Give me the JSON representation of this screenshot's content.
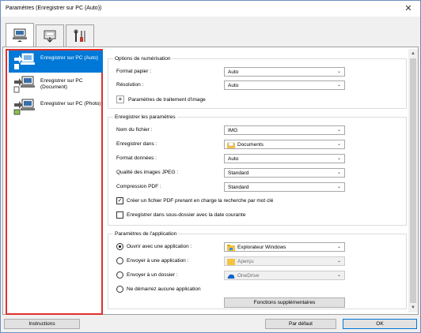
{
  "window": {
    "title": "Paramètres (Enregistrer sur PC (Auto))",
    "close_symbol": "✕"
  },
  "tabs": [
    {
      "icon": "scan-from-computer-icon"
    },
    {
      "icon": "scan-from-operation-panel-icon"
    },
    {
      "icon": "general-settings-tools-icon"
    }
  ],
  "sidebar": {
    "items": [
      {
        "label": "Enregistrer sur PC (Auto)",
        "icon": "save-to-pc-auto-icon",
        "selected": true
      },
      {
        "label": "Enregistrer sur PC (Document)",
        "icon": "save-to-pc-document-icon",
        "selected": false
      },
      {
        "label": "Enregistrer sur PC (Photo)",
        "icon": "save-to-pc-photo-icon",
        "selected": false
      }
    ]
  },
  "scan_options": {
    "title": "Options de numérisation",
    "paper_size_label": "Format papier :",
    "paper_size_value": "Auto",
    "resolution_label": "Résolution :",
    "resolution_value": "Auto",
    "image_processing_label": "Paramètres de traitement d'image",
    "expand_symbol": "+"
  },
  "save_settings": {
    "title": "Enregistrer les paramètres",
    "file_name_label": "Nom du fichier :",
    "file_name_value": "IMG",
    "save_in_label": "Enregistrer dans :",
    "save_in_value": "Documents",
    "data_format_label": "Format données :",
    "data_format_value": "Auto",
    "jpeg_quality_label": "Qualité des images JPEG :",
    "jpeg_quality_value": "Standard",
    "pdf_compression_label": "Compression PDF :",
    "pdf_compression_value": "Standard",
    "keyword_pdf_label": "Créer un fichier PDF prenant en charge la recherche par mot clé",
    "keyword_pdf_checked": true,
    "subfolder_label": "Enregistrer dans sous-dossier avec la date courante",
    "subfolder_checked": false,
    "check_symbol": "✓"
  },
  "app_settings": {
    "title": "Paramètres de l'application",
    "open_app_label": "Ouvrir avec une application :",
    "open_app_value": "Explorateur Windows",
    "send_app_label": "Envoyer à une application :",
    "send_app_value": "Aperçu",
    "send_folder_label": "Envoyer à un dossier :",
    "send_folder_value": "OneDrive",
    "no_app_label": "Ne démarrez aucune application",
    "selected_option": "open_app",
    "more_functions_label": "Fonctions supplémentaires"
  },
  "footer": {
    "instructions_label": "Instructions",
    "defaults_label": "Par défaut",
    "ok_label": "OK"
  },
  "dropdown_arrow": "⌄",
  "scroll_up": "▲",
  "scroll_down": "▼",
  "colors": {
    "accent": "#0078d7",
    "highlight_border": "#e0302e",
    "folder": "#f5c342",
    "onedrive": "#0a64c8"
  }
}
